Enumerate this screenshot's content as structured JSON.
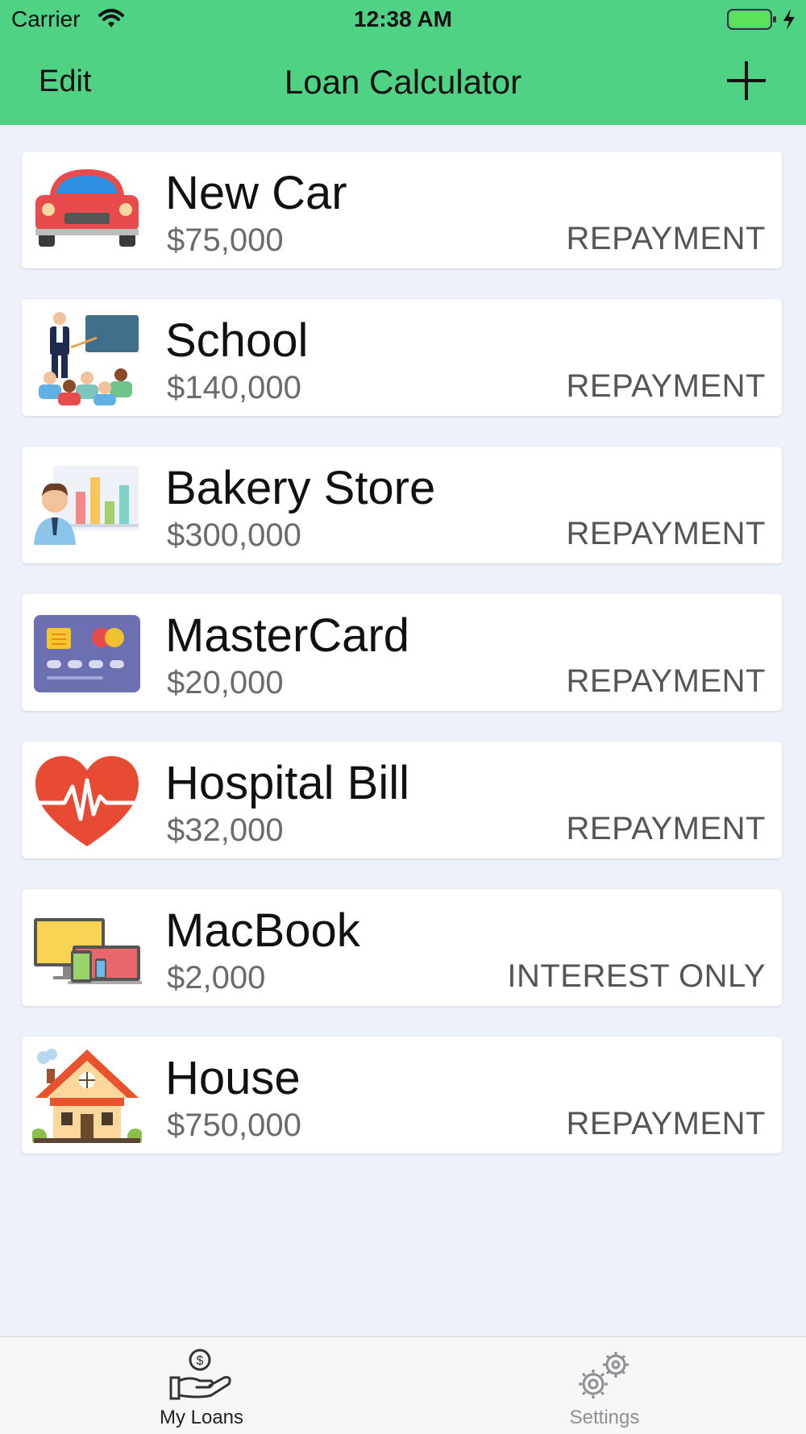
{
  "status_bar": {
    "carrier": "Carrier",
    "time": "12:38 AM"
  },
  "nav": {
    "edit_label": "Edit",
    "title": "Loan Calculator",
    "add_icon": "plus-icon"
  },
  "loans": [
    {
      "name": "New Car",
      "amount": "$75,000",
      "type": "REPAYMENT",
      "icon": "car-icon"
    },
    {
      "name": "School",
      "amount": "$140,000",
      "type": "REPAYMENT",
      "icon": "classroom-icon"
    },
    {
      "name": "Bakery Store",
      "amount": "$300,000",
      "type": "REPAYMENT",
      "icon": "business-chart-icon"
    },
    {
      "name": "MasterCard",
      "amount": "$20,000",
      "type": "REPAYMENT",
      "icon": "credit-card-icon"
    },
    {
      "name": "Hospital Bill",
      "amount": "$32,000",
      "type": "REPAYMENT",
      "icon": "heart-pulse-icon"
    },
    {
      "name": "MacBook",
      "amount": "$2,000",
      "type": "INTEREST ONLY",
      "icon": "devices-icon"
    },
    {
      "name": "House",
      "amount": "$750,000",
      "type": "REPAYMENT",
      "icon": "house-icon"
    }
  ],
  "tabs": [
    {
      "label": "My Loans",
      "icon": "loan-hand-icon",
      "active": true
    },
    {
      "label": "Settings",
      "icon": "gears-icon",
      "active": false
    }
  ],
  "colors": {
    "header": "#4fd283",
    "background": "#edf1f9",
    "card": "#ffffff"
  }
}
